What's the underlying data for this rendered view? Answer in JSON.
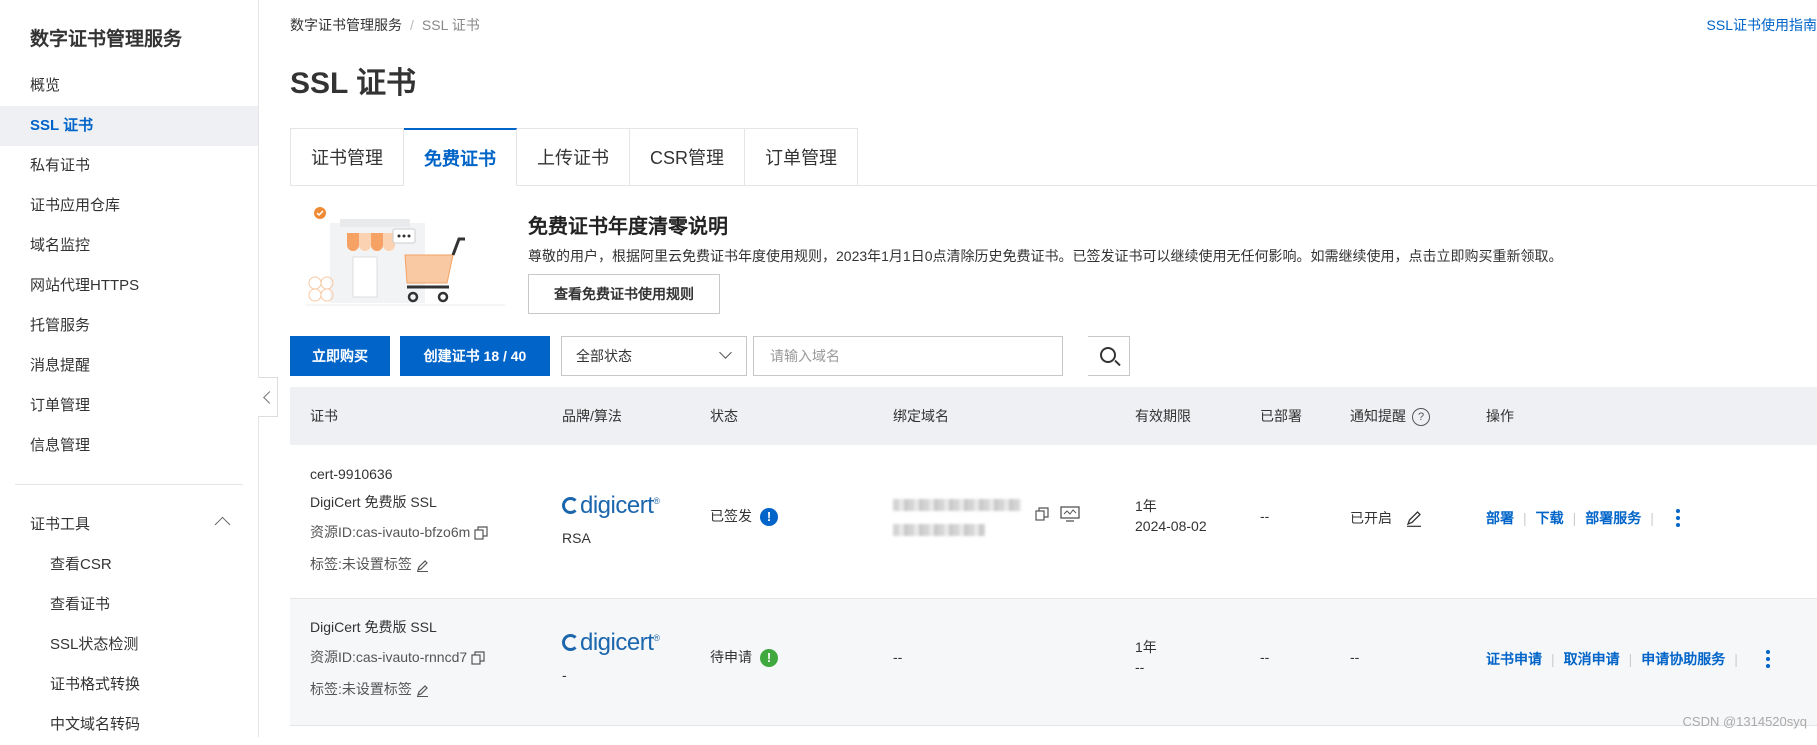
{
  "sidebar": {
    "title": "数字证书管理服务",
    "items": [
      {
        "label": "概览"
      },
      {
        "label": "SSL 证书",
        "active": true
      },
      {
        "label": "私有证书"
      },
      {
        "label": "证书应用仓库"
      },
      {
        "label": "域名监控"
      },
      {
        "label": "网站代理HTTPS"
      },
      {
        "label": "托管服务"
      },
      {
        "label": "消息提醒"
      },
      {
        "label": "订单管理"
      },
      {
        "label": "信息管理"
      }
    ],
    "tools_group": "证书工具",
    "tools": [
      {
        "label": "查看CSR"
      },
      {
        "label": "查看证书"
      },
      {
        "label": "SSL状态检测"
      },
      {
        "label": "证书格式转换"
      },
      {
        "label": "中文域名转码"
      }
    ]
  },
  "breadcrumb": {
    "root": "数字证书管理服务",
    "separator": "/",
    "current": "SSL 证书"
  },
  "guide_link": "SSL证书使用指南",
  "page_title": "SSL 证书",
  "tabs": [
    {
      "label": "证书管理"
    },
    {
      "label": "免费证书",
      "active": true
    },
    {
      "label": "上传证书"
    },
    {
      "label": "CSR管理"
    },
    {
      "label": "订单管理"
    }
  ],
  "banner": {
    "title": "免费证书年度清零说明",
    "text": "尊敬的用户，根据阿里云免费证书年度使用规则，2023年1月1日0点清除历史免费证书。已签发证书可以继续使用无任何影响。如需继续使用，点击立即购买重新领取。",
    "button": "查看免费证书使用规则"
  },
  "toolbar": {
    "buy_label": "立即购买",
    "create_label": "创建证书 18 / 40",
    "status_select": "全部状态",
    "search_placeholder": "请输入域名"
  },
  "table": {
    "headers": {
      "cert": "证书",
      "brand": "品牌/算法",
      "status": "状态",
      "domain": "绑定域名",
      "validity": "有效期限",
      "deployed": "已部署",
      "notify": "通知提醒",
      "ops": "操作"
    },
    "rows": [
      {
        "cert_id": "cert-9910636",
        "product": "DigiCert 免费版 SSL",
        "resource": "资源ID:cas-ivauto-bfzo6m",
        "tag": "标签:未设置标签",
        "brand": "digicert",
        "algo": "RSA",
        "status": "已签发",
        "status_icon": "!",
        "status_color": "#0064c8",
        "validity": "1年",
        "expiry": "2024-08-02",
        "deployed": "--",
        "notify": "已开启",
        "ops": [
          "部署",
          "下载",
          "部署服务"
        ]
      },
      {
        "product": "DigiCert 免费版 SSL",
        "resource": "资源ID:cas-ivauto-rnncd7",
        "tag": "标签:未设置标签",
        "brand": "digicert",
        "algo": "-",
        "status": "待申请",
        "status_icon": "!",
        "status_color": "#3fa83f",
        "domain": "--",
        "validity": "1年",
        "expiry": "--",
        "deployed": "--",
        "notify": "--",
        "ops": [
          "证书申请",
          "取消申请",
          "申请协助服务"
        ]
      }
    ]
  },
  "watermark": "CSDN @1314520syq"
}
